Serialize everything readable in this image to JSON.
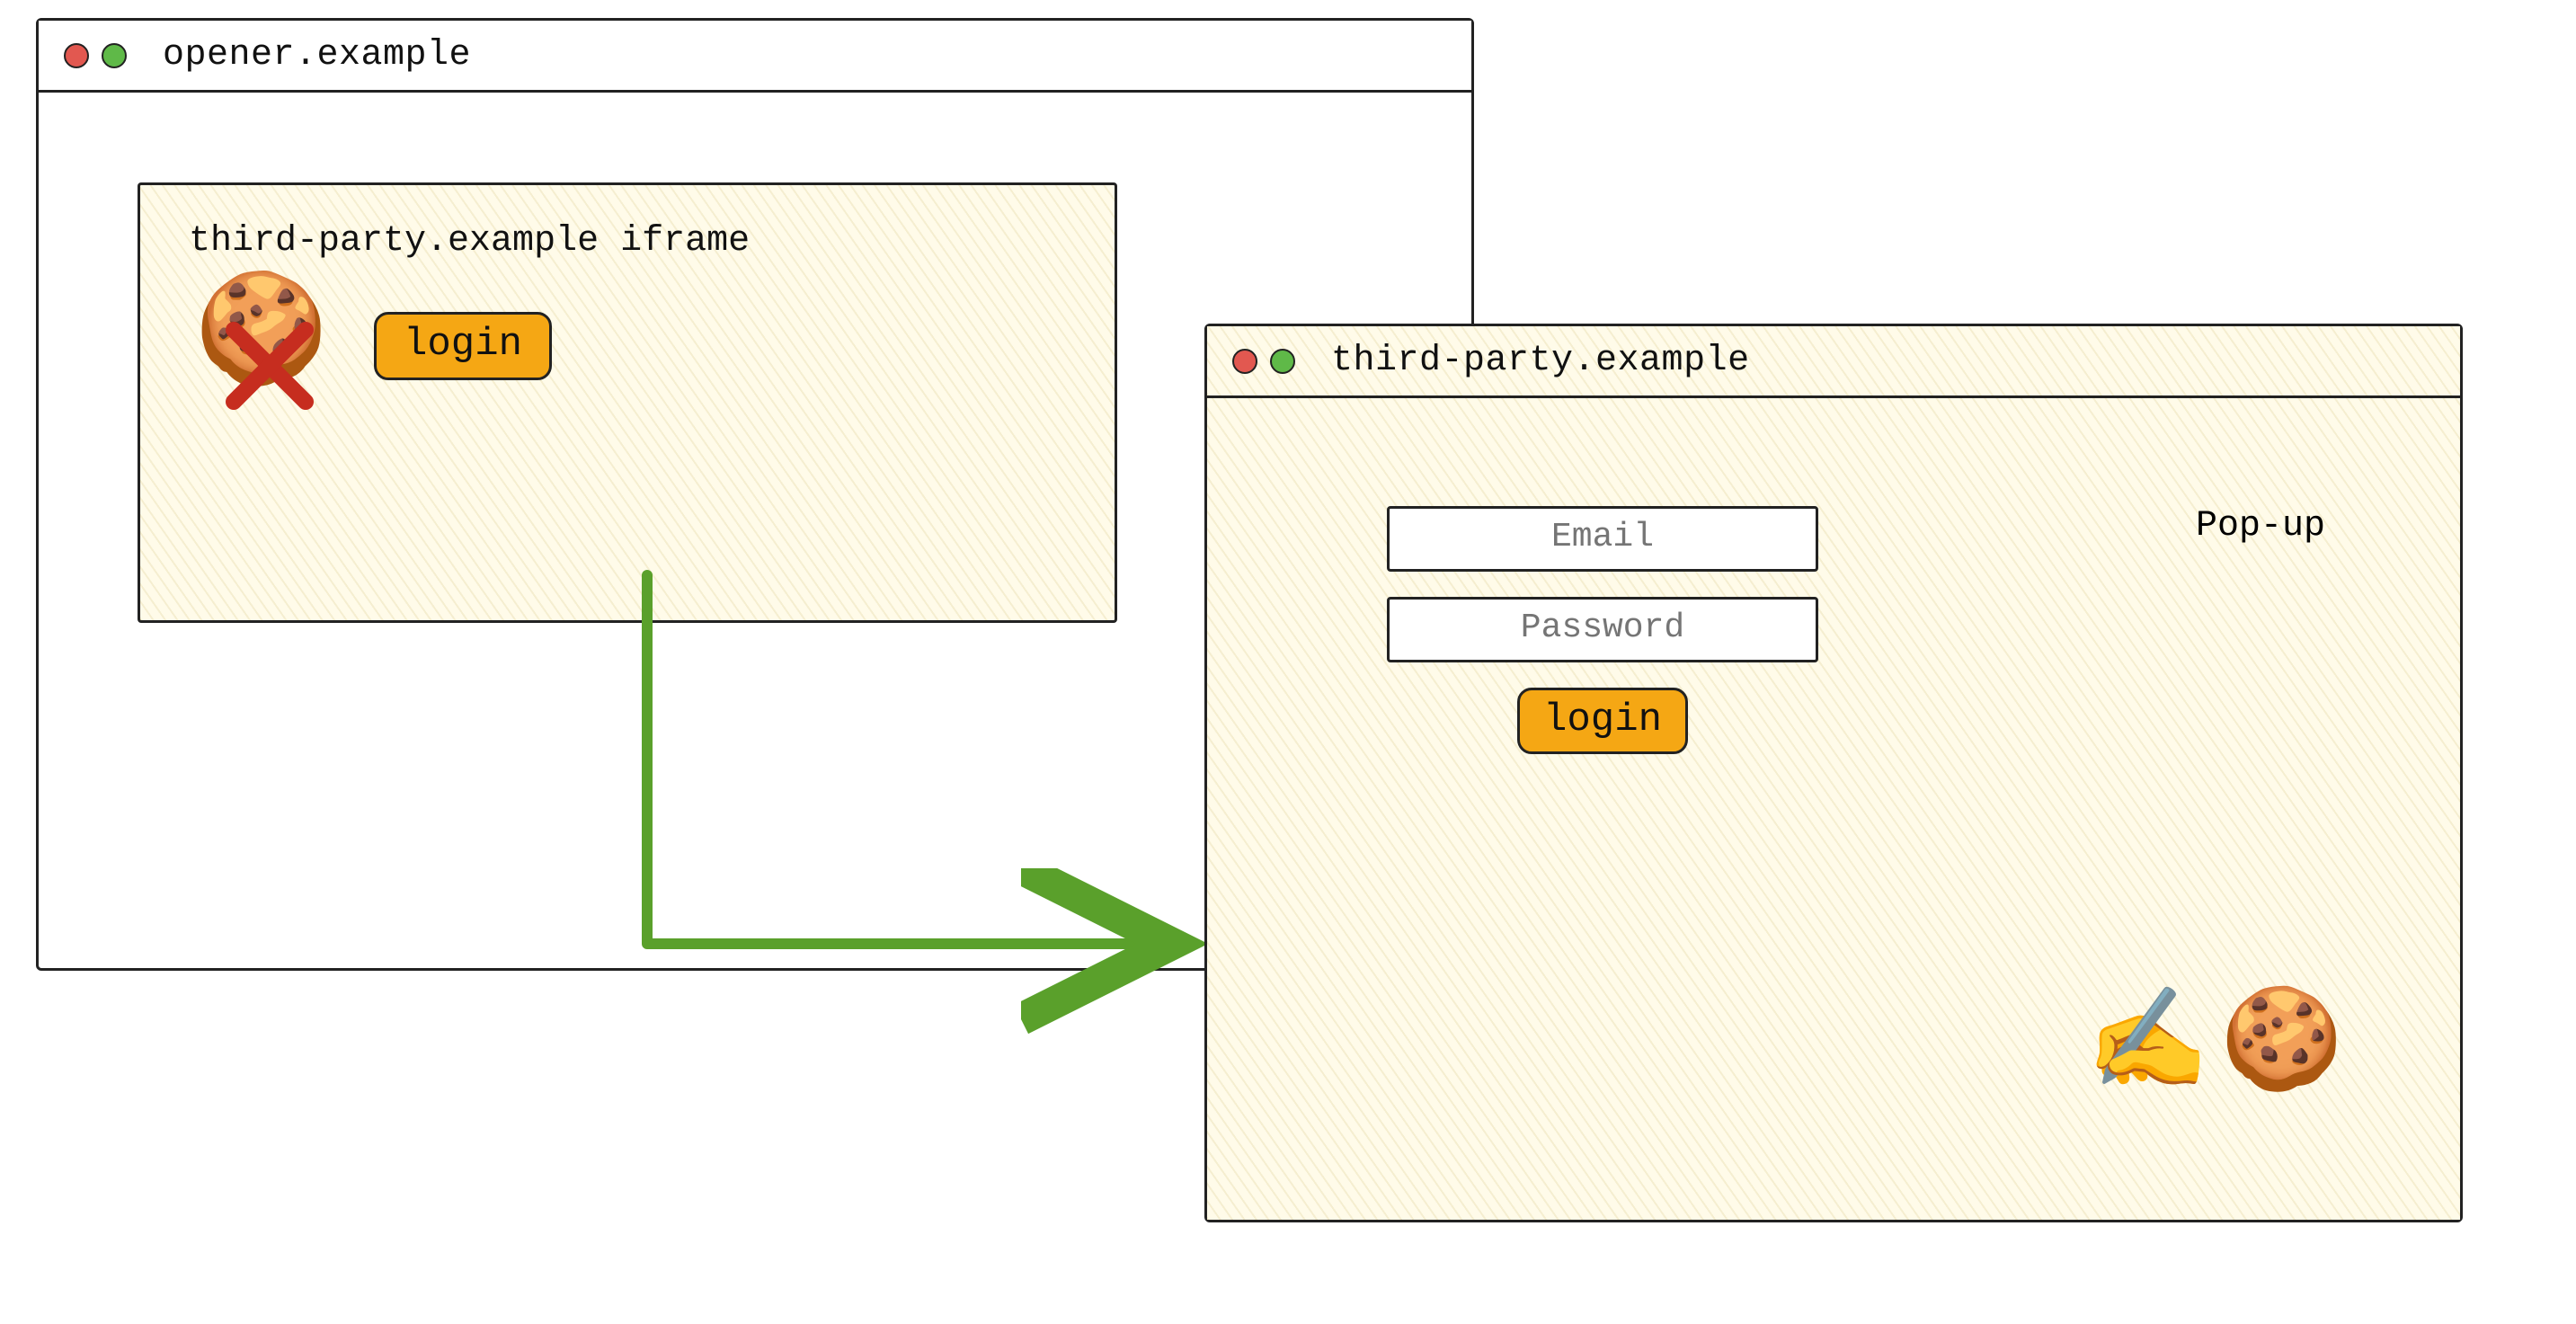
{
  "opener_window": {
    "title": "opener.example",
    "iframe": {
      "label": "third-party.example iframe",
      "cookie_icon": "🍪",
      "blocked_marker": "✕",
      "login_label": "login"
    }
  },
  "popup_window": {
    "title": "third-party.example",
    "side_label": "Pop-up",
    "email_placeholder": "Email",
    "password_placeholder": "Password",
    "login_label": "login",
    "writing_icon": "✍️",
    "cookie_icon": "🍪"
  },
  "colors": {
    "button_bg": "#f5a714",
    "arrow": "#5aa02b",
    "red_dot": "#e25850",
    "green_dot": "#5fb948",
    "cross": "#c62d1f"
  },
  "diagram": {
    "description": "Login button in third-party iframe (cookies blocked) opens a first-party pop-up on third-party.example where cookies can be written after login.",
    "arrow_from": "opener iframe login button",
    "arrow_to": "third-party.example pop-up window"
  }
}
